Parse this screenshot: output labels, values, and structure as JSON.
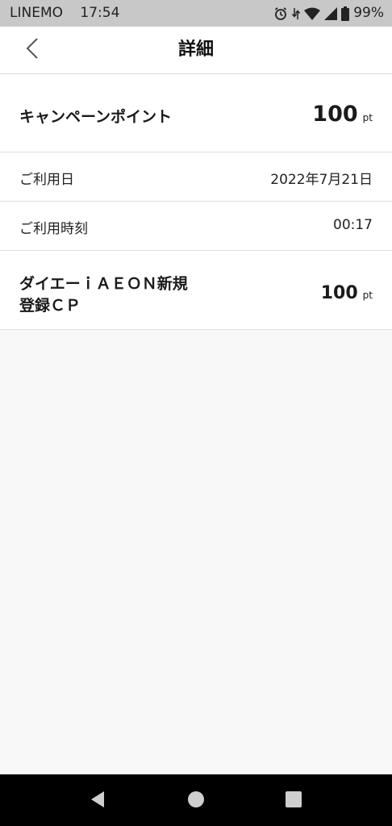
{
  "status_bar": {
    "carrier": "LINEMO",
    "time": "17:54",
    "battery": "99%"
  },
  "header": {
    "title": "詳細"
  },
  "details": {
    "points_label": "キャンペーンポイント",
    "points_value": "100",
    "points_unit": "pt",
    "date_label": "ご利用日",
    "date_value": "2022年7月21日",
    "time_label": "ご利用時刻",
    "time_value": "00:17",
    "merchant_line1": "ダイエーｉＡＥＯＮ新規",
    "merchant_line2": "登録ＣＰ",
    "merchant_points": "100",
    "merchant_unit": "pt"
  },
  "colors": {
    "status_bar_bg": "#c8c8c8",
    "page_bg": "#f8f8f8",
    "nav_bar_bg": "#000000"
  }
}
